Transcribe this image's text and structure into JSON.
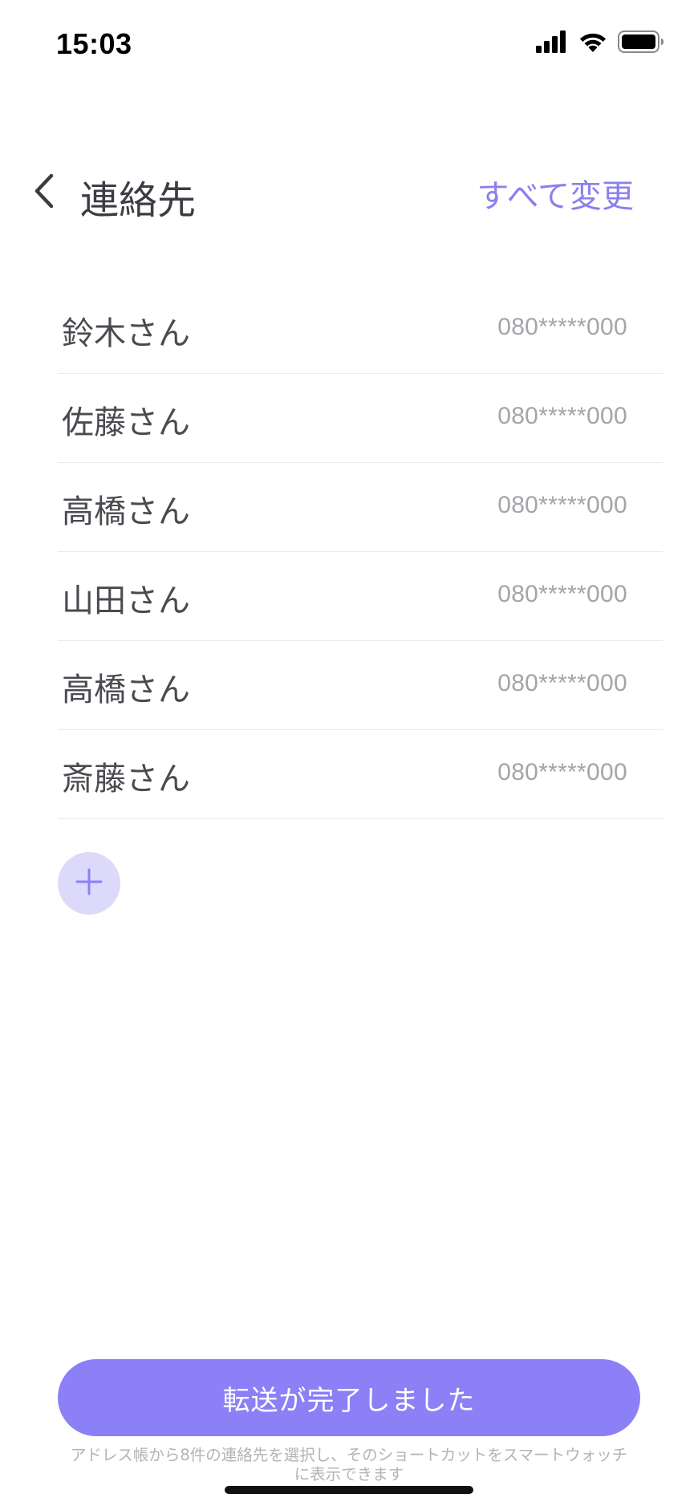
{
  "status_bar": {
    "time": "15:03",
    "icons": [
      "cellular-signal-icon",
      "wifi-icon",
      "battery-icon"
    ]
  },
  "header": {
    "back_icon": "chevron-left-icon",
    "title": "連絡先",
    "change_all_label": "すべて変更"
  },
  "contacts": [
    {
      "name": "鈴木さん",
      "phone": "080*****000"
    },
    {
      "name": "佐藤さん",
      "phone": "080*****000"
    },
    {
      "name": "高橋さん",
      "phone": "080*****000"
    },
    {
      "name": "山田さん",
      "phone": "080*****000"
    },
    {
      "name": "高橋さん",
      "phone": "080*****000"
    },
    {
      "name": "斎藤さん",
      "phone": "080*****000"
    }
  ],
  "add_button": {
    "icon": "plus-icon"
  },
  "footer": {
    "primary_button_label": "転送が完了しました",
    "footnote_line1": "アドレス帳から8件の連絡先を選択し、そのショートカットをスマートウォッチ",
    "footnote_line2": "に表示できます"
  },
  "colors": {
    "accent": "#8b80f6",
    "accent_text": "#8a80ee",
    "add_bg": "#dcd9fb",
    "divider": "#e9e9ee"
  }
}
